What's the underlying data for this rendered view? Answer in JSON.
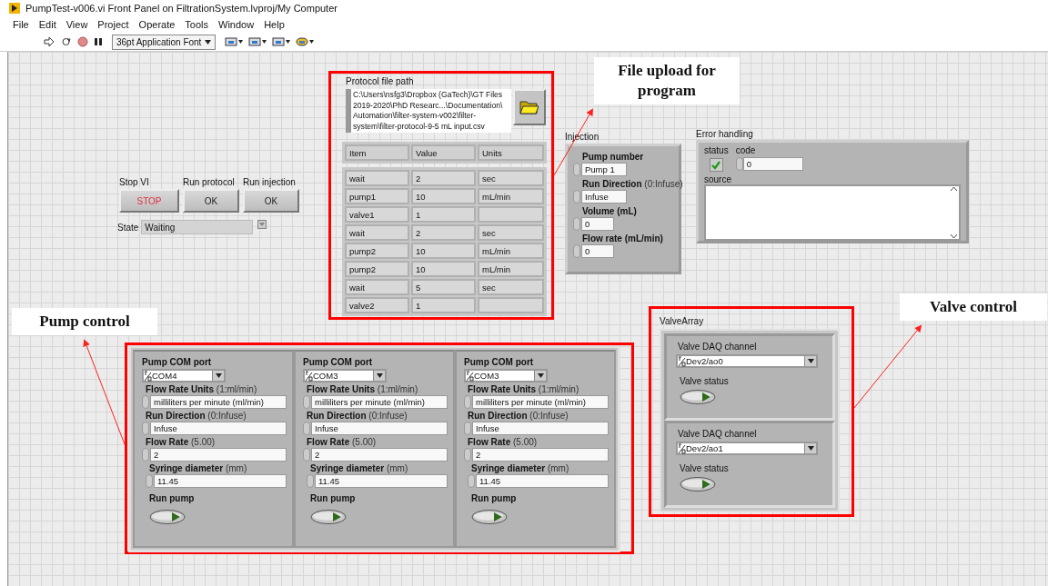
{
  "window": {
    "title": "PumpTest-v006.vi Front Panel on FiltrationSystem.lvproj/My Computer"
  },
  "menu": [
    "File",
    "Edit",
    "View",
    "Project",
    "Operate",
    "Tools",
    "Window",
    "Help"
  ],
  "toolbar": {
    "font": "36pt Application Font"
  },
  "buttons": [
    {
      "label": "Stop VI",
      "text": "STOP",
      "kind": "stop"
    },
    {
      "label": "Run protocol",
      "text": "OK",
      "kind": "ok"
    },
    {
      "label": "Run injection",
      "text": "OK",
      "kind": "ok"
    }
  ],
  "state": {
    "label": "State",
    "value": "Waiting"
  },
  "protocol": {
    "label": "Protocol file path",
    "path_lines": [
      "C:\\Users\\nsfg3\\Dropbox (GaTech)\\GT Files",
      "2019-2020\\PhD Researc...\\Documentation\\",
      "Automation\\filter-system-v002\\filter-",
      "system\\filter-protocol-9-5 mL input.csv"
    ],
    "columns": [
      "Item",
      "Value",
      "Units"
    ],
    "rows": [
      {
        "item": "wait",
        "value": "2",
        "units": "sec"
      },
      {
        "item": "pump1",
        "value": "10",
        "units": "mL/min"
      },
      {
        "item": "valve1",
        "value": "1"
      },
      {
        "item": "wait",
        "value": "2",
        "units": "sec"
      },
      {
        "item": "pump2",
        "value": "10",
        "units": "mL/min"
      },
      {
        "item": "pump2",
        "value": "10",
        "units": "mL/min"
      },
      {
        "item": "wait",
        "value": "5",
        "units": "sec"
      },
      {
        "item": "valve2",
        "value": "1"
      }
    ]
  },
  "injection": {
    "label": "Injection",
    "fields": [
      {
        "label": "Pump number",
        "value": "Pump 1",
        "kind": "wide"
      },
      {
        "label": "Run Direction",
        "note": "(0:Infuse)",
        "value": "Infuse",
        "kind": "wide"
      },
      {
        "label": "Volume (mL)",
        "value": "0",
        "kind": "narrow"
      },
      {
        "label": "Flow rate (mL/min)",
        "value": "0",
        "kind": "narrow"
      }
    ]
  },
  "error": {
    "label": "Error handling",
    "status_label": "status",
    "status": true,
    "code_label": "code",
    "code": "0",
    "source_label": "source"
  },
  "pumps": [
    {
      "com_label": "Pump COM port",
      "com": "COM4",
      "fields": [
        {
          "label": "Flow Rate Units",
          "note": "(1:ml/min)",
          "value": "milliliters per minute (ml/min)"
        },
        {
          "label": "Run Direction",
          "note": "(0:Infuse)",
          "value": "Infuse"
        },
        {
          "label": "Flow Rate",
          "note": "(5.00)",
          "value": "2"
        },
        {
          "label": "Syringe diameter",
          "note": "(mm)",
          "value": "11.45"
        }
      ],
      "run_label": "Run pump",
      "run": false
    },
    {
      "com_label": "Pump COM port",
      "com": "COM3",
      "fields": [
        {
          "label": "Flow Rate Units",
          "note": "(1:ml/min)",
          "value": "milliliters per minute (ml/min)"
        },
        {
          "label": "Run Direction",
          "note": "(0:Infuse)",
          "value": "Infuse"
        },
        {
          "label": "Flow Rate",
          "note": "(5.00)",
          "value": "2"
        },
        {
          "label": "Syringe diameter",
          "note": "(mm)",
          "value": "11.45"
        }
      ],
      "run_label": "Run pump",
      "run": false
    },
    {
      "com_label": "Pump COM port",
      "com": "COM3",
      "fields": [
        {
          "label": "Flow Rate Units",
          "note": "(1:ml/min)",
          "value": "milliliters per minute (ml/min)"
        },
        {
          "label": "Run Direction",
          "note": "(0:Infuse)",
          "value": "Infuse"
        },
        {
          "label": "Flow Rate",
          "note": "(5.00)",
          "value": "2"
        },
        {
          "label": "Syringe diameter",
          "note": "(mm)",
          "value": "11.45"
        }
      ],
      "run_label": "Run pump",
      "run": false
    }
  ],
  "valves": {
    "label": "ValveArray",
    "items": [
      {
        "channel_label": "Valve DAQ channel",
        "channel": "Dev2/ao0",
        "status_label": "Valve status",
        "on": false
      },
      {
        "channel_label": "Valve DAQ channel",
        "channel": "Dev2/ao1",
        "status_label": "Valve status",
        "on": false
      }
    ]
  },
  "annotations": [
    {
      "text": "File upload for program"
    },
    {
      "text": "Pump control"
    },
    {
      "text": "Valve control"
    }
  ]
}
